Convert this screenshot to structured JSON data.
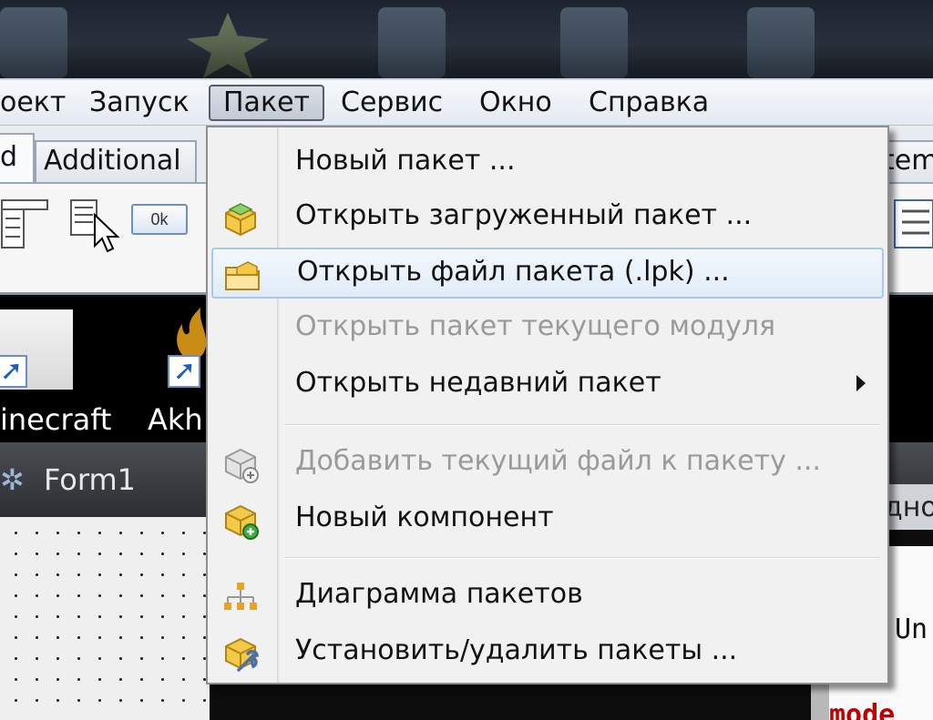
{
  "menubar": {
    "items": [
      "оект",
      "Запуск",
      "Пакет",
      "Сервис",
      "Окно",
      "Справка"
    ],
    "active": "Пакет"
  },
  "palette": {
    "tabs": [
      "d",
      "Additional",
      "tem"
    ],
    "ok_button": "0k"
  },
  "desktop": {
    "shortcuts": [
      "inecraft",
      "Akh"
    ]
  },
  "form": {
    "title": "Form1"
  },
  "editor": {
    "tab_fragment": "дно",
    "code_line_1": "Un",
    "code_line_2": "mode"
  },
  "dropdown": {
    "items": [
      {
        "label": "Новый пакет ...",
        "icon": "none",
        "enabled": true
      },
      {
        "label": "Открыть загруженный пакет ...",
        "icon": "open-package-icon",
        "enabled": true
      },
      {
        "label": "Открыть файл пакета (.lpk) ...",
        "icon": "open-package-file-icon",
        "enabled": true
      },
      {
        "label": "Открыть пакет текущего модуля",
        "icon": "none",
        "enabled": false
      },
      {
        "label": "Открыть недавний пакет",
        "icon": "submenu-arrow-icon",
        "enabled": true
      },
      {
        "label": "Добавить текущий файл к пакету ...",
        "icon": "add-file-to-package-icon",
        "enabled": false
      },
      {
        "label": "Новый компонент",
        "icon": "new-component-icon",
        "enabled": true
      },
      {
        "label": "Диаграмма пакетов",
        "icon": "package-diagram-icon",
        "enabled": true
      },
      {
        "label": "Установить/удалить пакеты ...",
        "icon": "install-packages-icon",
        "enabled": true
      }
    ]
  },
  "colors": {
    "menu_hover_border": "#a8c8ec",
    "disabled_text": "#9a9a9a",
    "package_icon_gold": "#f0c23a"
  }
}
